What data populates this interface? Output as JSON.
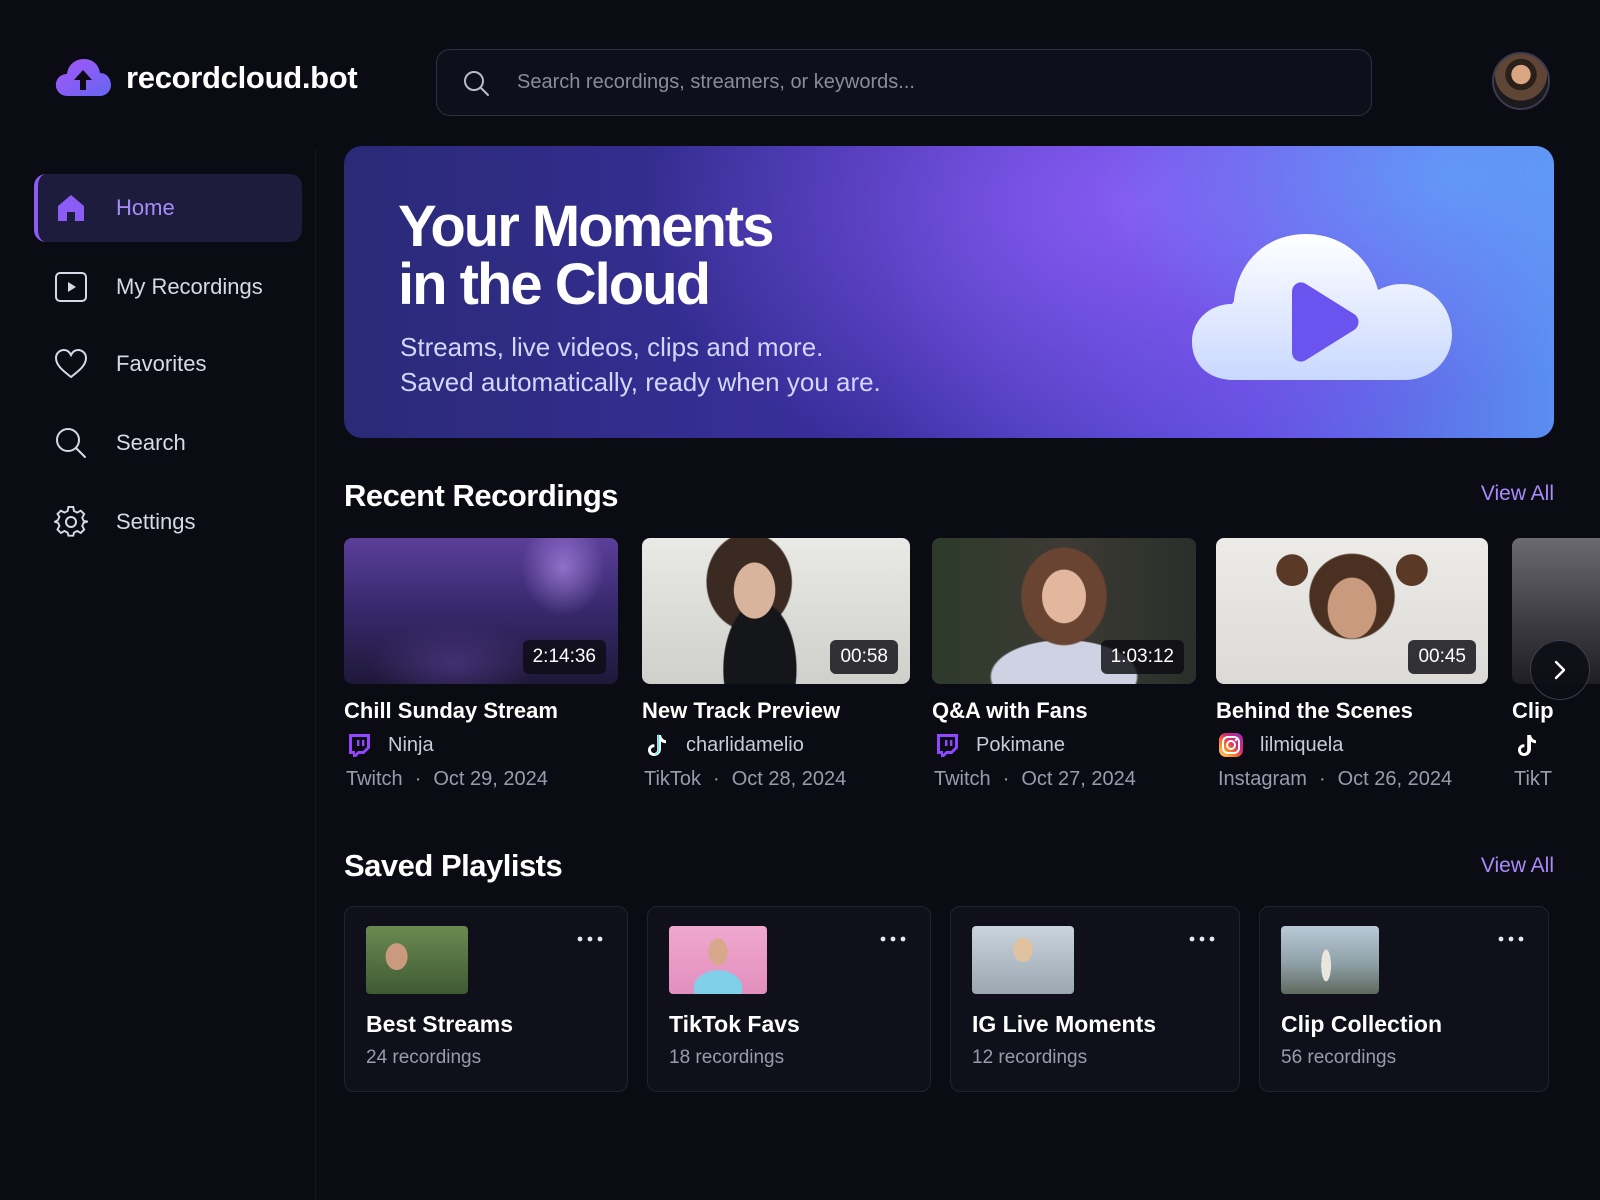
{
  "app": {
    "name": "recordcloud.bot",
    "accent": "#8b5cf6"
  },
  "search": {
    "placeholder": "Search recordings, streamers, or keywords..."
  },
  "sidebar": {
    "items": [
      {
        "label": "Home",
        "icon": "home-icon",
        "active": true
      },
      {
        "label": "My Recordings",
        "icon": "play-square-icon"
      },
      {
        "label": "Favorites",
        "icon": "heart-icon"
      },
      {
        "label": "Search",
        "icon": "search-icon"
      },
      {
        "label": "Settings",
        "icon": "gear-icon"
      }
    ]
  },
  "hero": {
    "title_line1": "Your Moments",
    "title_line2": "in the Cloud",
    "subtitle_line1": "Streams, live videos, clips and more.",
    "subtitle_line2": "Saved automatically, ready when you are.",
    "icon": "cloud-play-icon"
  },
  "recent": {
    "title": "Recent Recordings",
    "view_all": "View All",
    "items": [
      {
        "title": "Chill Sunday Stream",
        "creator": "Ninja",
        "platform": "Twitch",
        "date": "Oct 29, 2024",
        "duration": "2:14:36",
        "platform_icon": "twitch-icon"
      },
      {
        "title": "New Track Preview",
        "creator": "charlidamelio",
        "platform": "TikTok",
        "date": "Oct 28, 2024",
        "duration": "00:58",
        "platform_icon": "tiktok-icon"
      },
      {
        "title": "Q&A with Fans",
        "creator": "Pokimane",
        "platform": "Twitch",
        "date": "Oct 27, 2024",
        "duration": "1:03:12",
        "platform_icon": "twitch-icon"
      },
      {
        "title": "Behind the Scenes",
        "creator": "lilmiquela",
        "platform": "Instagram",
        "date": "Oct 26, 2024",
        "duration": "00:45",
        "platform_icon": "instagram-icon"
      },
      {
        "title": "Clip",
        "creator": "",
        "platform": "TikT",
        "date": "",
        "duration": "",
        "platform_icon": "tiktok-icon"
      }
    ]
  },
  "playlists": {
    "title": "Saved Playlists",
    "view_all": "View All",
    "items": [
      {
        "title": "Best Streams",
        "count": "24 recordings"
      },
      {
        "title": "TikTok Favs",
        "count": "18 recordings"
      },
      {
        "title": "IG Live Moments",
        "count": "12 recordings"
      },
      {
        "title": "Clip Collection",
        "count": "56 recordings"
      }
    ]
  }
}
